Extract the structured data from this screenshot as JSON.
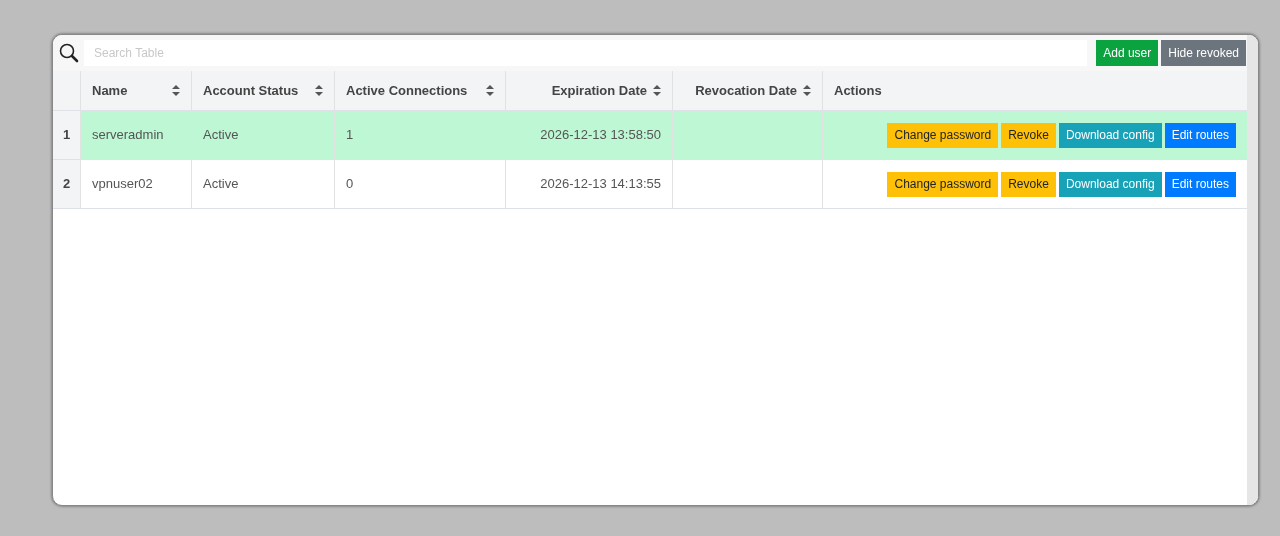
{
  "toolbar": {
    "search": {
      "placeholder": "Search Table"
    },
    "buttons": [
      {
        "label": "Add user",
        "kind": "success"
      },
      {
        "label": "Hide revoked",
        "kind": "secondary"
      }
    ]
  },
  "table": {
    "columns": [
      {
        "label": "Name",
        "sortable": true
      },
      {
        "label": "Account Status",
        "sortable": true
      },
      {
        "label": "Active Connections",
        "sortable": true
      },
      {
        "label": "Expiration Date",
        "sortable": true
      },
      {
        "label": "Revocation Date",
        "sortable": true
      },
      {
        "label": "Actions",
        "sortable": false
      }
    ],
    "rows": [
      {
        "index": "1",
        "highlighted": true,
        "cells": [
          "serveradmin",
          "Active",
          "1",
          "2026-12-13 13:58:50"
        ],
        "actions": [
          {
            "label": "Change password",
            "kind": "warning"
          },
          {
            "label": "Revoke",
            "kind": "warning"
          },
          {
            "label": "Download config",
            "kind": "info"
          },
          {
            "label": "Edit routes",
            "kind": "primary"
          }
        ]
      },
      {
        "index": "2",
        "highlighted": false,
        "cells": [
          "vpnuser02",
          "Active",
          "0",
          "2026-12-13 14:13:55"
        ],
        "actions": [
          {
            "label": "Change password",
            "kind": "warning"
          },
          {
            "label": "Revoke",
            "kind": "warning"
          },
          {
            "label": "Download config",
            "kind": "info"
          },
          {
            "label": "Edit routes",
            "kind": "primary"
          }
        ]
      }
    ]
  }
}
